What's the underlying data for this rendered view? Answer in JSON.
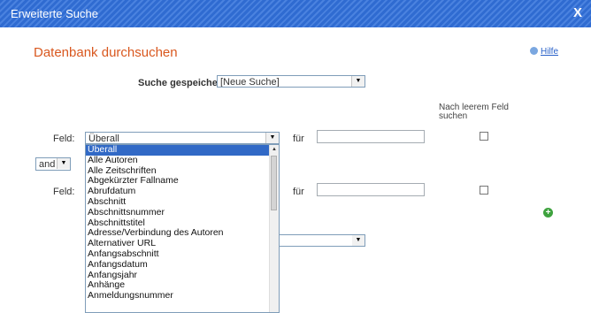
{
  "window": {
    "title": "Erweiterte Suche",
    "close_label": "X"
  },
  "page": {
    "heading": "Datenbank durchsuchen",
    "help_label": "Hilfe"
  },
  "saved_search": {
    "label": "Suche gespeichert",
    "value": "[Neue Suche]"
  },
  "empty_field_label": "Nach leerem Feld suchen",
  "rows": [
    {
      "field_label": "Feld:",
      "field_value": "Überall",
      "for_label": "für"
    },
    {
      "field_label": "Feld:",
      "for_label": "für"
    }
  ],
  "operator": {
    "value": "and"
  },
  "field_options": [
    "Überall",
    "Alle Autoren",
    "Alle Zeitschriften",
    "Abgekürzter Fallname",
    "Abrufdatum",
    "Abschnitt",
    "Abschnittsnummer",
    "Abschnittstitel",
    "Adresse/Verbindung des Autoren",
    "Alternativer URL",
    "Anfangsabschnitt",
    "Anfangsdatum",
    "Anfangsjahr",
    "Anhänge",
    "Anmeldungsnummer"
  ],
  "colors": {
    "titlebar": "#2f6bd1",
    "heading": "#d9581f",
    "selection": "#3169c6",
    "add": "#3ea23e"
  }
}
